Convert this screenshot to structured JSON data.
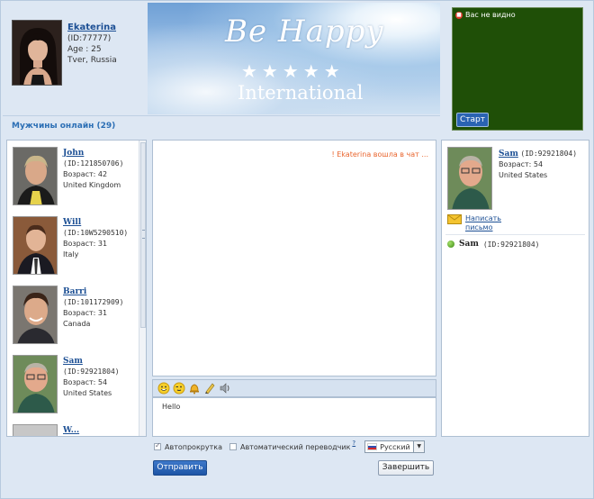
{
  "profile": {
    "name": "Ekaterina",
    "id": "(ID:77777)",
    "age": "Age : 25",
    "location": "Tver, Russia"
  },
  "banner": {
    "title": "Be Happy",
    "stars": "★★★★★",
    "subtitle": "International"
  },
  "camera": {
    "status": "Вас не видно",
    "start_label": "Старт",
    "background_color": "#1f4f07"
  },
  "online_header": "Мужчины онлайн (29)",
  "users": [
    {
      "name": "John",
      "id": "(ID:121850706)",
      "age": "Возраст: 42",
      "country": "United Kingdom"
    },
    {
      "name": "Will",
      "id": "(ID:10W5290510)",
      "age": "Возраст: 31",
      "country": "Italy"
    },
    {
      "name": "Barri",
      "id": "(ID:101172909)",
      "age": "Возраст: 31",
      "country": "Canada"
    },
    {
      "name": "Sam",
      "id": "(ID:92921804)",
      "age": "Возраст: 54",
      "country": "United States"
    },
    {
      "name": "W...",
      "id": "",
      "age": "",
      "country": ""
    }
  ],
  "chat": {
    "system_message": "! Ekaterina вошла в чат ...",
    "input_text": "Hello"
  },
  "toolbar": {
    "icons": [
      "smiley-icon",
      "wink-icon",
      "bell-icon",
      "pen-icon",
      "speaker-icon"
    ]
  },
  "selected_user": {
    "name": "Sam",
    "id": "(ID:92921804)",
    "age": "Возраст: 54",
    "country": "United States",
    "write_label_1": "Написать",
    "write_label_2": "письмо",
    "online_name": "Sam",
    "online_id": "(ID:92921804)"
  },
  "options": {
    "autoscroll_label": "Автопрокрутка",
    "autoscroll_checked": true,
    "autotranslate_label": "Автоматический переводчик",
    "autotranslate_checked": false,
    "help_label": "?",
    "language": "Русский"
  },
  "buttons": {
    "send": "Отправить",
    "end": "Завершить"
  },
  "colors": {
    "accent": "#1c4f94",
    "header_text": "#2c6fb5",
    "system_message": "#e9652e",
    "panel_bg": "#dde7f3"
  }
}
